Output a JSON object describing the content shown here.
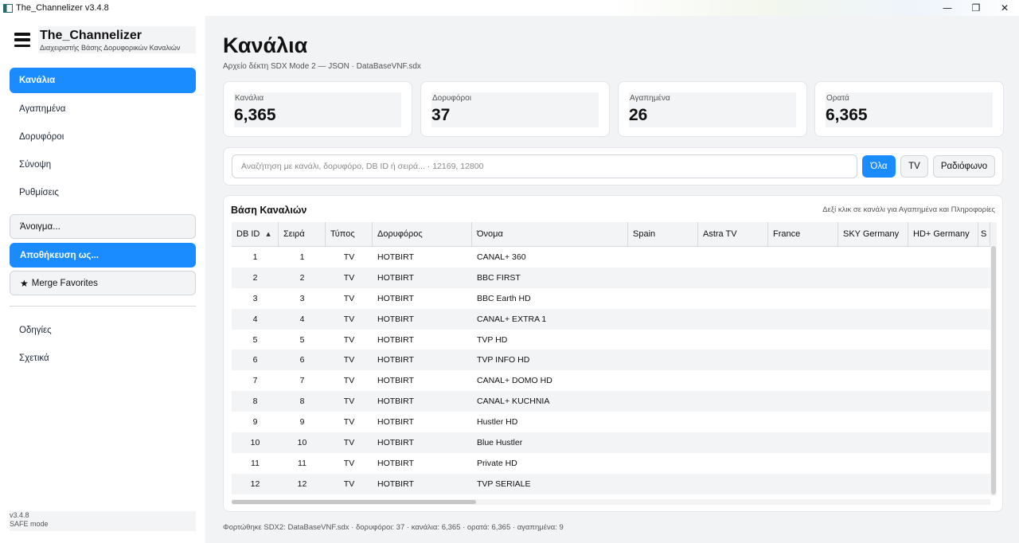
{
  "window": {
    "title": "The_Channelizer v3.4.8",
    "controls": {
      "minimize": "—",
      "maximize": "❐",
      "close": "✕"
    }
  },
  "sidebar": {
    "brand_title": "The_Channelizer",
    "brand_subtitle": "Διαχειριστής Βάσης Δορυφορικών Καναλιών",
    "nav": [
      {
        "label": "Κανάλια",
        "active": true
      },
      {
        "label": "Αγαπημένα",
        "active": false
      },
      {
        "label": "Δορυφόροι",
        "active": false
      },
      {
        "label": "Σύνοψη",
        "active": false
      },
      {
        "label": "Ρυθμίσεις",
        "active": false
      }
    ],
    "actions": {
      "open": "Άνοιγμα...",
      "save_as": "Αποθήκευση ως...",
      "merge": "Merge Favorites"
    },
    "links": [
      {
        "label": "Οδηγίες"
      },
      {
        "label": "Σχετικά"
      }
    ],
    "version": "v3.4.8",
    "mode": "SAFE mode"
  },
  "main": {
    "title": "Κανάλια",
    "subtitle": "Αρχείο δέκτη SDX Mode 2 — JSON  ·  DataBaseVNF.sdx",
    "stats": [
      {
        "label": "Κανάλια",
        "value": "6,365"
      },
      {
        "label": "Δορυφόροι",
        "value": "37"
      },
      {
        "label": "Αγαπημένα",
        "value": "26"
      },
      {
        "label": "Ορατά",
        "value": "6,365"
      }
    ],
    "search": {
      "placeholder": "Αναζήτηση με κανάλι, δορυφόρο, DB ID ή σειρά... · 12169, 12800",
      "filters": [
        {
          "label": "Όλα",
          "active": true
        },
        {
          "label": "TV",
          "active": false
        },
        {
          "label": "Ραδιόφωνο",
          "active": false
        }
      ]
    },
    "table": {
      "title": "Βάση Καναλιών",
      "hint": "Δεξί κλικ σε κανάλι για Αγαπημένα και Πληροφορίες",
      "columns": [
        "DB ID",
        "Σειρά",
        "Τύπος",
        "Δορυφόρος",
        "Όνομα",
        "Spain",
        "Astra TV",
        "France",
        "SKY Germany",
        "HD+ Germany",
        "S"
      ],
      "sort_indicator": "▲",
      "rows": [
        [
          "1",
          "1",
          "TV",
          "HOTBIRT",
          "CANAL+ 360"
        ],
        [
          "2",
          "2",
          "TV",
          "HOTBIRT",
          "BBC FIRST"
        ],
        [
          "3",
          "3",
          "TV",
          "HOTBIRT",
          "BBC Earth HD"
        ],
        [
          "4",
          "4",
          "TV",
          "HOTBIRT",
          "CANAL+ EXTRA 1"
        ],
        [
          "5",
          "5",
          "TV",
          "HOTBIRT",
          "TVP HD"
        ],
        [
          "6",
          "6",
          "TV",
          "HOTBIRT",
          "TVP INFO HD"
        ],
        [
          "7",
          "7",
          "TV",
          "HOTBIRT",
          "CANAL+ DOMO HD"
        ],
        [
          "8",
          "8",
          "TV",
          "HOTBIRT",
          "CANAL+ KUCHNIA"
        ],
        [
          "9",
          "9",
          "TV",
          "HOTBIRT",
          "Hustler HD"
        ],
        [
          "10",
          "10",
          "TV",
          "HOTBIRT",
          "Blue Hustler"
        ],
        [
          "11",
          "11",
          "TV",
          "HOTBIRT",
          "Private HD"
        ],
        [
          "12",
          "12",
          "TV",
          "HOTBIRT",
          "TVP SERIALE"
        ]
      ]
    },
    "status": "Φορτώθηκε SDX2: DataBaseVNF.sdx  ·  δορυφόροι: 37  ·  κανάλια: 6,365  ·  ορατά: 6,365  ·  αγαπημένα: 9"
  },
  "colors": {
    "accent": "#1a8cff",
    "main_bg": "#f1f3f5",
    "card_bg": "#ffffff"
  }
}
